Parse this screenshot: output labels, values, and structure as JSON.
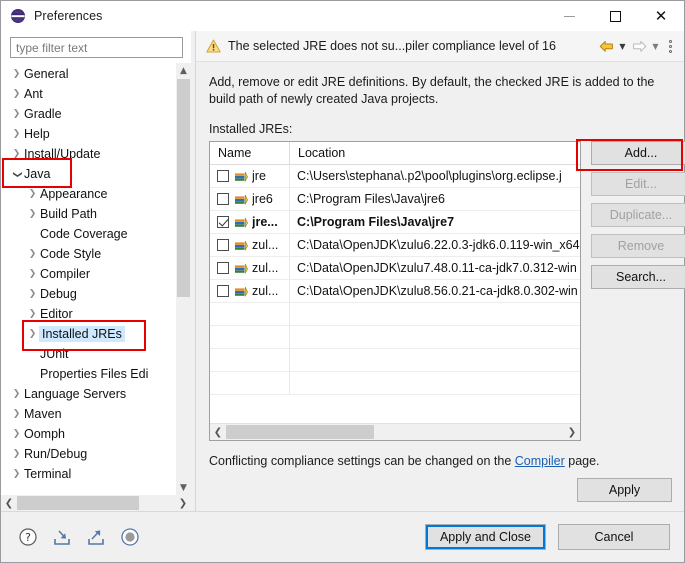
{
  "window": {
    "title": "Preferences",
    "app_icon": "eclipse-icon",
    "minimize_label": "Minimize",
    "maximize_label": "Maximize",
    "close_label": "Close"
  },
  "sidebar": {
    "filter": {
      "value": "",
      "placeholder": "type filter text"
    },
    "items": [
      {
        "label": "General",
        "twisty": "collapsed",
        "indent": 0,
        "selected": false
      },
      {
        "label": "Ant",
        "twisty": "collapsed",
        "indent": 0,
        "selected": false
      },
      {
        "label": "Gradle",
        "twisty": "collapsed",
        "indent": 0,
        "selected": false
      },
      {
        "label": "Help",
        "twisty": "collapsed",
        "indent": 0,
        "selected": false
      },
      {
        "label": "Install/Update",
        "twisty": "collapsed",
        "indent": 0,
        "selected": false
      },
      {
        "label": "Java",
        "twisty": "expanded",
        "indent": 0,
        "selected": false
      },
      {
        "label": "Appearance",
        "twisty": "collapsed",
        "indent": 1,
        "selected": false
      },
      {
        "label": "Build Path",
        "twisty": "collapsed",
        "indent": 1,
        "selected": false
      },
      {
        "label": "Code Coverage",
        "twisty": "none",
        "indent": 1,
        "selected": false
      },
      {
        "label": "Code Style",
        "twisty": "collapsed",
        "indent": 1,
        "selected": false
      },
      {
        "label": "Compiler",
        "twisty": "collapsed",
        "indent": 1,
        "selected": false
      },
      {
        "label": "Debug",
        "twisty": "collapsed",
        "indent": 1,
        "selected": false
      },
      {
        "label": "Editor",
        "twisty": "collapsed",
        "indent": 1,
        "selected": false
      },
      {
        "label": "Installed JREs",
        "twisty": "collapsed",
        "indent": 1,
        "selected": true
      },
      {
        "label": "JUnit",
        "twisty": "none",
        "indent": 1,
        "selected": false
      },
      {
        "label": "Properties Files Edi",
        "twisty": "none",
        "indent": 1,
        "selected": false
      },
      {
        "label": "Language Servers",
        "twisty": "collapsed",
        "indent": 0,
        "selected": false
      },
      {
        "label": "Maven",
        "twisty": "collapsed",
        "indent": 0,
        "selected": false
      },
      {
        "label": "Oomph",
        "twisty": "collapsed",
        "indent": 0,
        "selected": false
      },
      {
        "label": "Run/Debug",
        "twisty": "collapsed",
        "indent": 0,
        "selected": false
      },
      {
        "label": "Terminal",
        "twisty": "collapsed",
        "indent": 0,
        "selected": false
      }
    ]
  },
  "message_bar": {
    "icon": "warning-icon",
    "text": "The selected JRE does not su...piler compliance level of 16",
    "back_label": "Back",
    "forward_label": "Forward",
    "menu_label": "View Menu"
  },
  "page": {
    "description": "Add, remove or edit JRE definitions. By default, the checked JRE is added to the build path of newly created Java projects.",
    "list_label": "Installed JREs:",
    "table": {
      "columns": [
        "Name",
        "Location"
      ],
      "rows": [
        {
          "checked": false,
          "bold": false,
          "name": "jre",
          "location": "C:\\Users\\stephana\\.p2\\pool\\plugins\\org.eclipse.j"
        },
        {
          "checked": false,
          "bold": false,
          "name": "jre6",
          "location": "C:\\Program Files\\Java\\jre6"
        },
        {
          "checked": true,
          "bold": true,
          "name": "jre...",
          "location": "C:\\Program Files\\Java\\jre7"
        },
        {
          "checked": false,
          "bold": false,
          "name": "zul...",
          "location": "C:\\Data\\OpenJDK\\zulu6.22.0.3-jdk6.0.119-win_x64"
        },
        {
          "checked": false,
          "bold": false,
          "name": "zul...",
          "location": "C:\\Data\\OpenJDK\\zulu7.48.0.11-ca-jdk7.0.312-win"
        },
        {
          "checked": false,
          "bold": false,
          "name": "zul...",
          "location": "C:\\Data\\OpenJDK\\zulu8.56.0.21-ca-jdk8.0.302-win"
        }
      ],
      "empty_rows": 4
    },
    "buttons": [
      {
        "label": "Add...",
        "enabled": true
      },
      {
        "label": "Edit...",
        "enabled": false
      },
      {
        "label": "Duplicate...",
        "enabled": false
      },
      {
        "label": "Remove",
        "enabled": false
      },
      {
        "label": "Search...",
        "enabled": true
      }
    ],
    "compliance_prefix": "Conflicting compliance settings can be changed on the ",
    "compliance_link": "Compiler",
    "compliance_suffix": " page.",
    "apply_label": "Apply"
  },
  "footer": {
    "icons": [
      "help-icon",
      "import-icon",
      "export-icon",
      "restore-defaults-icon"
    ],
    "apply_and_close_label": "Apply and Close",
    "cancel_label": "Cancel"
  },
  "colors": {
    "accent_focus": "#0078d7",
    "link": "#1a5fb4",
    "annotation": "#e60000",
    "selection": "#cde8ff",
    "warning": "#f0a800"
  }
}
